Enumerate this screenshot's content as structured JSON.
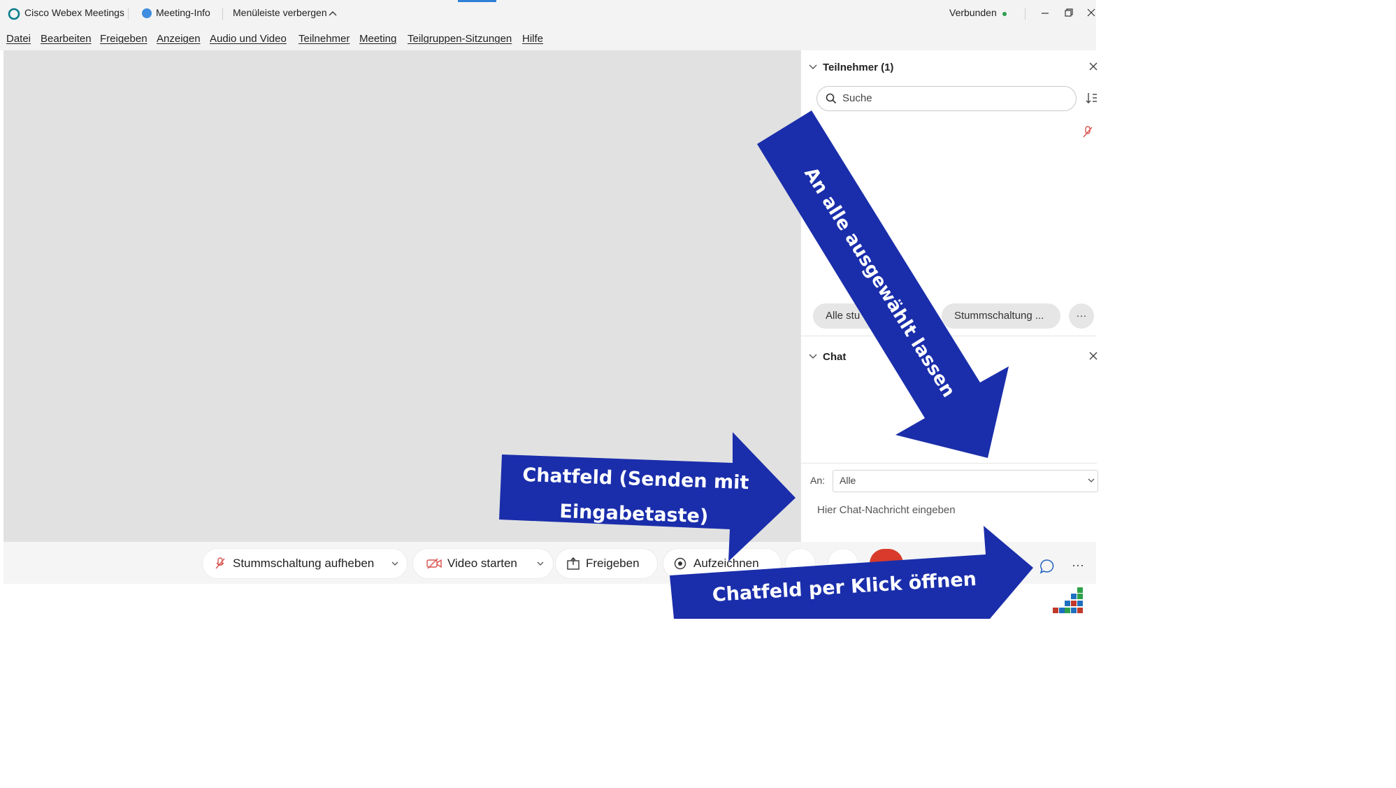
{
  "titlebar": {
    "app_title": "Cisco Webex Meetings",
    "meeting_info": "Meeting-Info",
    "hide_menu": "Menüleiste verbergen",
    "status": "Verbunden",
    "status_color": "#2e9e4f"
  },
  "menu": {
    "items": [
      "Datei",
      "Bearbeiten",
      "Freigeben",
      "Anzeigen",
      "Audio und Video",
      "Teilnehmer",
      "Meeting",
      "Teilgruppen-Sitzungen",
      "Hilfe"
    ]
  },
  "participants": {
    "title": "Teilnehmer (1)",
    "search_placeholder": "Suche",
    "mute_all_label": "Alle stu",
    "unmute_label": "Stummschaltung ...",
    "more_label": "···"
  },
  "chat": {
    "title": "Chat",
    "to_label": "An:",
    "to_value": "Alle",
    "message_placeholder": "Hier Chat-Nachricht eingeben"
  },
  "controls": {
    "unmute_label": "Stummschaltung aufheben",
    "video_label": "Video starten",
    "share_label": "Freigeben",
    "record_label": "Aufzeichnen",
    "more_label": "···",
    "end_color": "#d83b2b",
    "mute_icon_color": "#d9534f"
  },
  "annotations": {
    "arrow_down_text": "An alle ausgewählt lassen",
    "arrow_right_line1": "Chatfeld (Senden mit",
    "arrow_right_line2": "Eingabetaste)",
    "arrow_bottom_text": "Chatfeld per Klick öffnen",
    "arrow_color": "#1a2eab"
  }
}
